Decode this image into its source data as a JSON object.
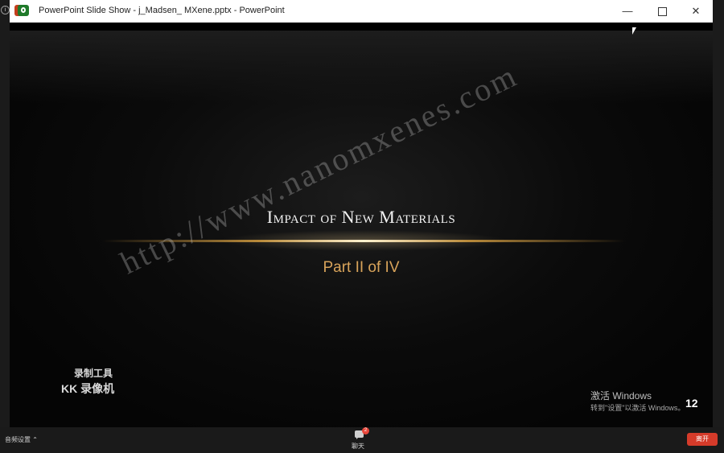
{
  "window": {
    "title": "PowerPoint Slide Show  -  j_Madsen_ MXene.pptx - PowerPoint",
    "minimize": "—",
    "close": "✕"
  },
  "slide": {
    "title": "Impact of New Materials",
    "subtitle": "Part II of IV",
    "number": "12"
  },
  "watermark": "http://www.nanomxenes.com",
  "recorder": {
    "line1": "录制工具",
    "line2": "KK 录像机"
  },
  "activation": {
    "title": "激活 Windows",
    "subtitle": "转到\"设置\"以激活 Windows。"
  },
  "toolbar": {
    "audio_label": "音频设置 ⌃",
    "chat_badge": "2",
    "chat_label": "聊天",
    "leave_label": "离开"
  },
  "colors": {
    "subtitle": "#d8a35a",
    "leave_button": "#d53b2a"
  }
}
